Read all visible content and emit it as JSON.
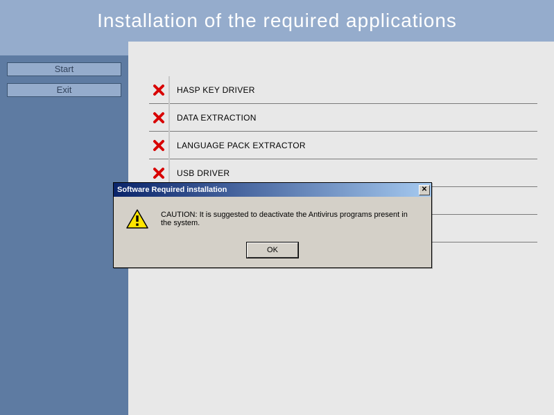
{
  "header": {
    "title": "Installation of the required applications"
  },
  "sidebar": {
    "start_label": "Start",
    "exit_label": "Exit"
  },
  "items": [
    {
      "status": "fail",
      "label": "HASP KEY DRIVER"
    },
    {
      "status": "fail",
      "label": "DATA EXTRACTION"
    },
    {
      "status": "fail",
      "label": "LANGUAGE PACK EXTRACTOR"
    },
    {
      "status": "fail",
      "label": "USB DRIVER"
    },
    {
      "status": "",
      "label": ""
    },
    {
      "status": "",
      "label": ""
    }
  ],
  "dialog": {
    "title": "Software Required installation",
    "message": "CAUTION: It is suggested to deactivate the Antivirus programs present in the system.",
    "ok_label": "OK"
  },
  "colors": {
    "header_bg": "#95accc",
    "sidebar_bg": "#5e7ba2",
    "content_bg": "#e8e8e8",
    "fail_x": "#d80000",
    "dialog_titlebar_start": "#0a246a",
    "dialog_titlebar_end": "#a6caf0",
    "dialog_bg": "#d4d0c8"
  }
}
